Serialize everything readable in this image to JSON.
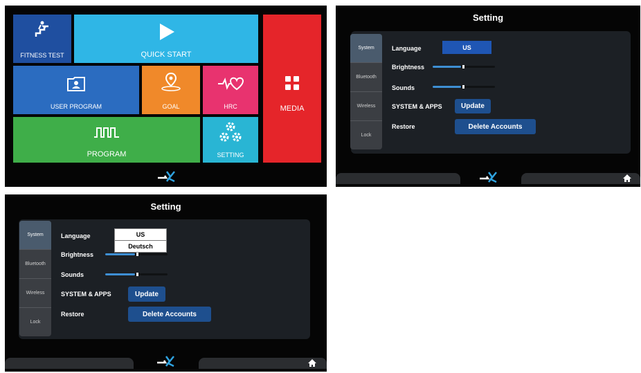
{
  "home": {
    "tiles": {
      "fitness_test": "FITNESS TEST",
      "quick_start": "QUICK START",
      "user_program": "USER PROGRAM",
      "goal": "GOAL",
      "hrc": "HRC",
      "media": "MEDIA",
      "program": "PROGRAM",
      "setting": "SETTING"
    },
    "colors": {
      "fitness_test": "#1f4fa0",
      "quick_start": "#2fb6e6",
      "user_program": "#2b6cc0",
      "goal": "#f0892a",
      "hrc": "#e8336f",
      "media": "#e5252a",
      "program": "#3fae49",
      "setting": "#29b5d4"
    }
  },
  "settings_1": {
    "title": "Setting",
    "tabs": [
      "System",
      "Bluetooth",
      "Wireless",
      "Lock"
    ],
    "language_label": "Language",
    "language_value": "US",
    "brightness_label": "Brightness",
    "brightness_level": 0.5,
    "sounds_label": "Sounds",
    "sounds_level": 0.5,
    "system_apps_label": "SYSTEM & APPS",
    "update_button": "Update",
    "restore_label": "Restore",
    "delete_accounts_button": "Delete Accounts"
  },
  "settings_2": {
    "title": "Setting",
    "tabs": [
      "System",
      "Bluetooth",
      "Wireless",
      "Lock"
    ],
    "language_label": "Language",
    "language_options": [
      "US",
      "Deutsch"
    ],
    "brightness_label": "Brightness",
    "brightness_level": 0.5,
    "sounds_label": "Sounds",
    "sounds_level": 0.5,
    "system_apps_label": "SYSTEM & APPS",
    "update_button": "Update",
    "restore_label": "Restore",
    "delete_accounts_button": "Delete Accounts"
  },
  "icons": [
    "stairs-icon",
    "play-icon",
    "user-folder-icon",
    "location-pin-icon",
    "heart-pulse-icon",
    "grid-icon",
    "pulse-wave-icon",
    "gears-icon",
    "brand-logo-icon",
    "home-icon"
  ]
}
